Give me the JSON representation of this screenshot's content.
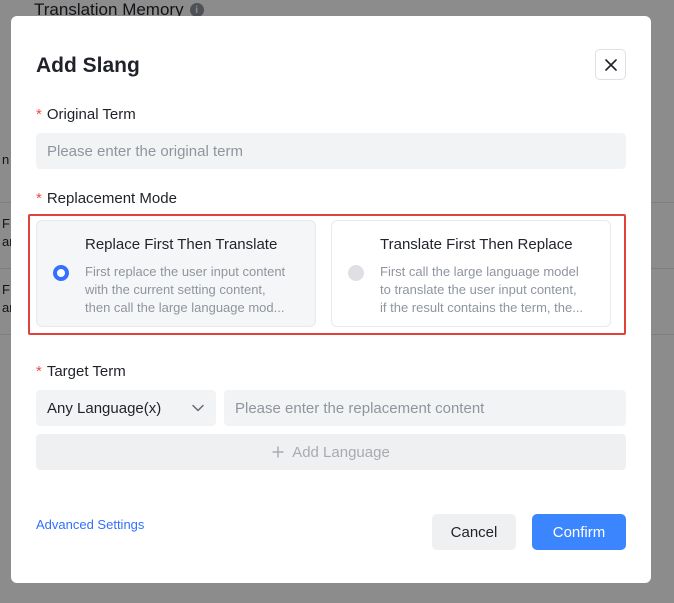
{
  "background": {
    "title": "Translation Memory",
    "edge_texts": [
      "n",
      "F",
      "an",
      "F",
      "an"
    ]
  },
  "modal": {
    "title": "Add Slang",
    "original_term": {
      "label": "Original Term",
      "required_mark": "*",
      "placeholder": "Please enter the original term",
      "value": ""
    },
    "replacement_mode": {
      "label": "Replacement Mode",
      "required_mark": "*",
      "options": [
        {
          "title": "Replace First Then Translate",
          "desc_lines": [
            "First replace the user input content",
            "with the current setting content,",
            "then call the large language mod..."
          ],
          "selected": true
        },
        {
          "title": "Translate First Then Replace",
          "desc_lines": [
            "First call the large language model",
            "to translate the user input content,",
            "if the result contains the term, the..."
          ],
          "selected": false
        }
      ]
    },
    "target_term": {
      "label": "Target Term",
      "required_mark": "*",
      "language_select": "Any Language(x)",
      "placeholder": "Please enter the replacement content",
      "value": ""
    },
    "add_language_label": "Add Language",
    "advanced_settings_link": "Advanced Settings",
    "cancel_label": "Cancel",
    "confirm_label": "Confirm"
  },
  "colors": {
    "accent": "#3b86ff",
    "required": "#f54a45",
    "highlight_border": "#e0413b",
    "overlay": "rgba(0,0,0,0.45)"
  },
  "icons": {
    "close": "close-icon",
    "info": "info-icon",
    "dropdown": "chevron-down-icon",
    "add": "plus-icon"
  }
}
